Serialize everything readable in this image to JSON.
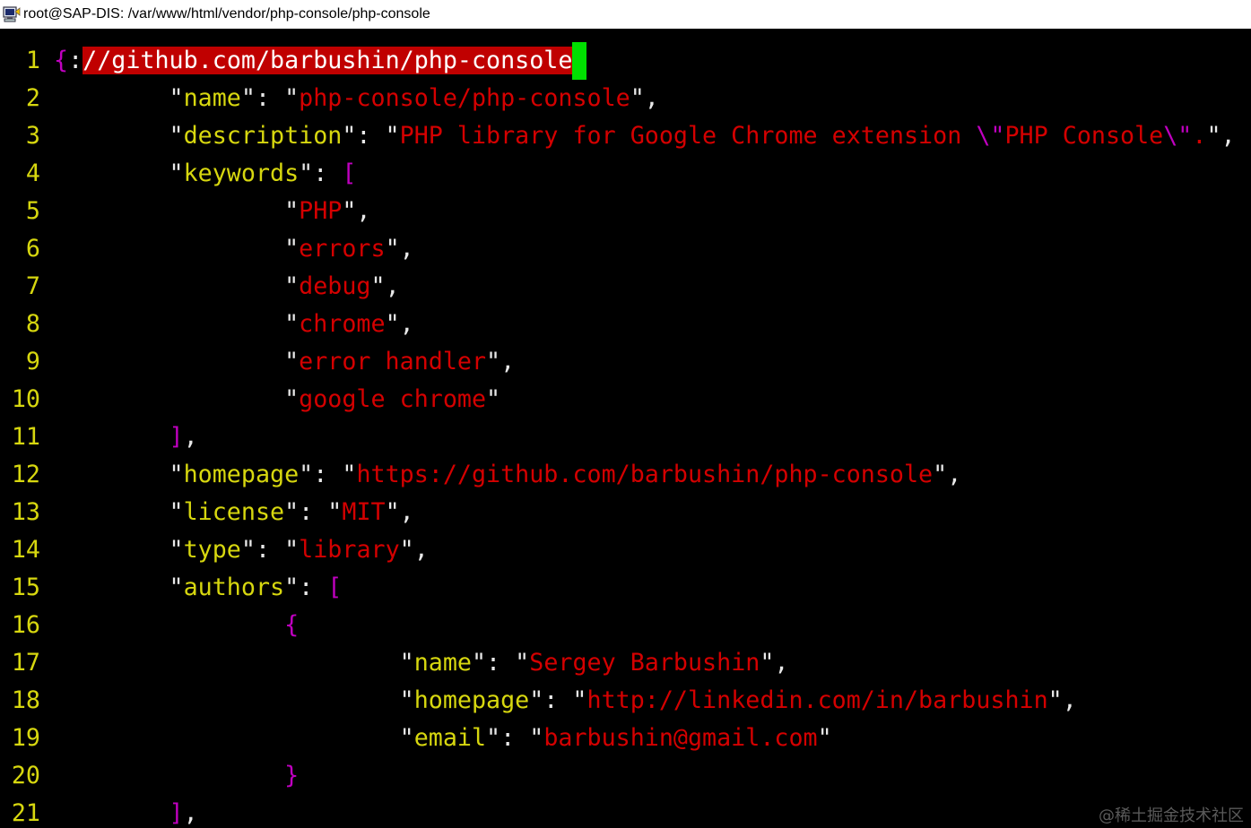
{
  "window": {
    "title": "root@SAP-DIS: /var/www/html/vendor/php-console/php-console"
  },
  "colors": {
    "background": "#000000",
    "line_number": "#d7d70f",
    "key": "#d7d70f",
    "string": "#d40000",
    "bracket": "#c000c0",
    "punctuation": "#e8e8e8",
    "search_highlight": "#c00000",
    "cursor": "#00e000"
  },
  "editor": {
    "lines": [
      {
        "n": "1",
        "tokens": [
          {
            "t": "{",
            "c": "p"
          },
          {
            "t": ":",
            "c": "w"
          },
          {
            "t": "//github.com/barbushin/php-console",
            "c": "hl"
          },
          {
            "t": " ",
            "c": "cursor"
          }
        ]
      },
      {
        "n": "2",
        "tokens": [
          {
            "t": "\t\"",
            "c": "w"
          },
          {
            "t": "name",
            "c": "k"
          },
          {
            "t": "\": \"",
            "c": "w"
          },
          {
            "t": "php-console/php-console",
            "c": "s"
          },
          {
            "t": "\",",
            "c": "w"
          }
        ]
      },
      {
        "n": "3",
        "tokens": [
          {
            "t": "\t\"",
            "c": "w"
          },
          {
            "t": "description",
            "c": "k"
          },
          {
            "t": "\": \"",
            "c": "w"
          },
          {
            "t": "PHP library for Google Chrome extension ",
            "c": "s"
          },
          {
            "t": "\\\"",
            "c": "p"
          },
          {
            "t": "PHP Console",
            "c": "s"
          },
          {
            "t": "\\\"",
            "c": "p"
          },
          {
            "t": ".",
            "c": "s"
          },
          {
            "t": "\",",
            "c": "w"
          }
        ]
      },
      {
        "n": "4",
        "tokens": [
          {
            "t": "\t\"",
            "c": "w"
          },
          {
            "t": "keywords",
            "c": "k"
          },
          {
            "t": "\": ",
            "c": "w"
          },
          {
            "t": "[",
            "c": "p"
          }
        ]
      },
      {
        "n": "5",
        "tokens": [
          {
            "t": "\t\t\"",
            "c": "w"
          },
          {
            "t": "PHP",
            "c": "s"
          },
          {
            "t": "\",",
            "c": "w"
          }
        ]
      },
      {
        "n": "6",
        "tokens": [
          {
            "t": "\t\t\"",
            "c": "w"
          },
          {
            "t": "errors",
            "c": "s"
          },
          {
            "t": "\",",
            "c": "w"
          }
        ]
      },
      {
        "n": "7",
        "tokens": [
          {
            "t": "\t\t\"",
            "c": "w"
          },
          {
            "t": "debug",
            "c": "s"
          },
          {
            "t": "\",",
            "c": "w"
          }
        ]
      },
      {
        "n": "8",
        "tokens": [
          {
            "t": "\t\t\"",
            "c": "w"
          },
          {
            "t": "chrome",
            "c": "s"
          },
          {
            "t": "\",",
            "c": "w"
          }
        ]
      },
      {
        "n": "9",
        "tokens": [
          {
            "t": "\t\t\"",
            "c": "w"
          },
          {
            "t": "error handler",
            "c": "s"
          },
          {
            "t": "\",",
            "c": "w"
          }
        ]
      },
      {
        "n": "10",
        "tokens": [
          {
            "t": "\t\t\"",
            "c": "w"
          },
          {
            "t": "google chrome",
            "c": "s"
          },
          {
            "t": "\"",
            "c": "w"
          }
        ]
      },
      {
        "n": "11",
        "tokens": [
          {
            "t": "\t",
            "c": "w"
          },
          {
            "t": "]",
            "c": "p"
          },
          {
            "t": ",",
            "c": "w"
          }
        ]
      },
      {
        "n": "12",
        "tokens": [
          {
            "t": "\t\"",
            "c": "w"
          },
          {
            "t": "homepage",
            "c": "k"
          },
          {
            "t": "\": \"",
            "c": "w"
          },
          {
            "t": "https://github.com/barbushin/php-console",
            "c": "s"
          },
          {
            "t": "\",",
            "c": "w"
          }
        ]
      },
      {
        "n": "13",
        "tokens": [
          {
            "t": "\t\"",
            "c": "w"
          },
          {
            "t": "license",
            "c": "k"
          },
          {
            "t": "\": \"",
            "c": "w"
          },
          {
            "t": "MIT",
            "c": "s"
          },
          {
            "t": "\",",
            "c": "w"
          }
        ]
      },
      {
        "n": "14",
        "tokens": [
          {
            "t": "\t\"",
            "c": "w"
          },
          {
            "t": "type",
            "c": "k"
          },
          {
            "t": "\": \"",
            "c": "w"
          },
          {
            "t": "library",
            "c": "s"
          },
          {
            "t": "\",",
            "c": "w"
          }
        ]
      },
      {
        "n": "15",
        "tokens": [
          {
            "t": "\t\"",
            "c": "w"
          },
          {
            "t": "authors",
            "c": "k"
          },
          {
            "t": "\": ",
            "c": "w"
          },
          {
            "t": "[",
            "c": "p"
          }
        ]
      },
      {
        "n": "16",
        "tokens": [
          {
            "t": "\t\t",
            "c": "w"
          },
          {
            "t": "{",
            "c": "p"
          }
        ]
      },
      {
        "n": "17",
        "tokens": [
          {
            "t": "\t\t\t\"",
            "c": "w"
          },
          {
            "t": "name",
            "c": "k"
          },
          {
            "t": "\": \"",
            "c": "w"
          },
          {
            "t": "Sergey Barbushin",
            "c": "s"
          },
          {
            "t": "\",",
            "c": "w"
          }
        ]
      },
      {
        "n": "18",
        "tokens": [
          {
            "t": "\t\t\t\"",
            "c": "w"
          },
          {
            "t": "homepage",
            "c": "k"
          },
          {
            "t": "\": \"",
            "c": "w"
          },
          {
            "t": "http://linkedin.com/in/barbushin",
            "c": "s"
          },
          {
            "t": "\",",
            "c": "w"
          }
        ]
      },
      {
        "n": "19",
        "tokens": [
          {
            "t": "\t\t\t\"",
            "c": "w"
          },
          {
            "t": "email",
            "c": "k"
          },
          {
            "t": "\": \"",
            "c": "w"
          },
          {
            "t": "barbushin@gmail.com",
            "c": "s"
          },
          {
            "t": "\"",
            "c": "w"
          }
        ]
      },
      {
        "n": "20",
        "tokens": [
          {
            "t": "\t\t",
            "c": "w"
          },
          {
            "t": "}",
            "c": "p"
          }
        ]
      },
      {
        "n": "21",
        "tokens": [
          {
            "t": "\t",
            "c": "w"
          },
          {
            "t": "]",
            "c": "p"
          },
          {
            "t": ",",
            "c": "w"
          }
        ]
      }
    ]
  },
  "watermark": "@稀土掘金技术社区"
}
